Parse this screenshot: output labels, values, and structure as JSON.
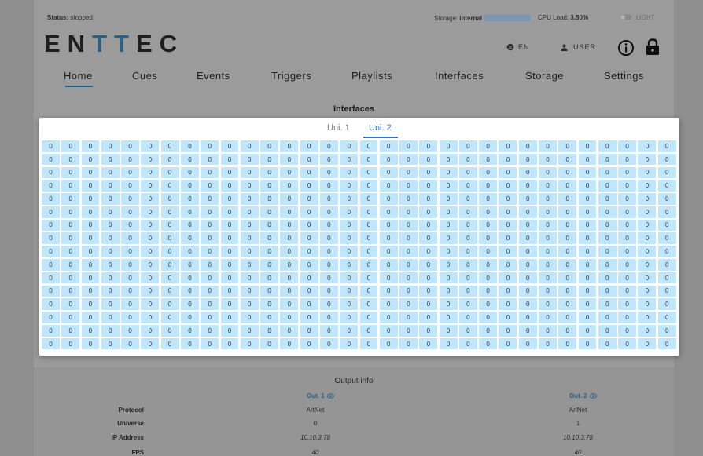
{
  "status": {
    "label": "Status:",
    "value": "stopped"
  },
  "storage": {
    "label": "Storage:",
    "value": "internal"
  },
  "cpu": {
    "label": "CPU Load:",
    "value": "3.50%"
  },
  "theme_toggle": {
    "label": "LIGHT"
  },
  "logo": {
    "prefix": "EN",
    "highlight": "TT",
    "suffix": "EC"
  },
  "header": {
    "language": "EN",
    "user": "USER"
  },
  "nav": {
    "tabs": [
      "Home",
      "Cues",
      "Events",
      "Triggers",
      "Playlists",
      "Interfaces",
      "Storage",
      "Settings"
    ],
    "active": "Home"
  },
  "section_title": "Interfaces",
  "universe_tabs": {
    "tabs": [
      "Uni. 1",
      "Uni. 2"
    ],
    "active": "Uni. 2"
  },
  "dmx_grid": {
    "rows": 16,
    "columns": 32,
    "value": "0"
  },
  "output_info": {
    "title": "Output info",
    "outputs": [
      {
        "name": "Out. 1",
        "protocol": "ArtNet",
        "universe": "0",
        "ip": "10.10.3.78",
        "fps": "40"
      },
      {
        "name": "Out. 2",
        "protocol": "ArtNet",
        "universe": "1",
        "ip": "10.10.3.78",
        "fps": "40"
      }
    ],
    "labels": {
      "protocol": "Protocol",
      "universe": "Universe",
      "ip": "IP Address",
      "fps": "FPS"
    }
  },
  "colors": {
    "accent": "#2d5f82",
    "tab_active": "#2f77c7",
    "cell": "#bfe6fb"
  }
}
